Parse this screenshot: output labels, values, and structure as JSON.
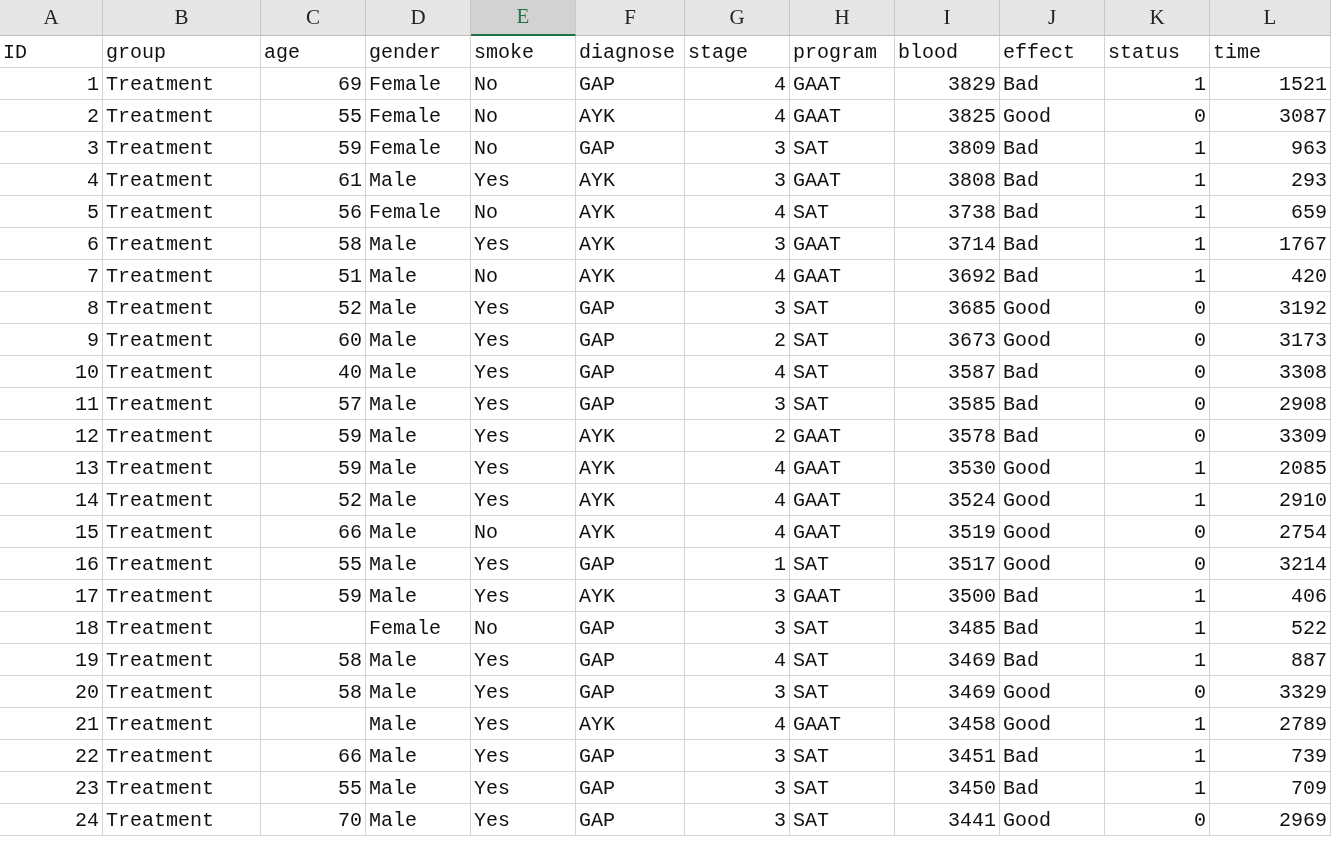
{
  "sheet": {
    "columns": [
      {
        "letter": "A",
        "selected": false,
        "kind": "number"
      },
      {
        "letter": "B",
        "selected": false,
        "kind": "text"
      },
      {
        "letter": "C",
        "selected": false,
        "kind": "number"
      },
      {
        "letter": "D",
        "selected": false,
        "kind": "text"
      },
      {
        "letter": "E",
        "selected": true,
        "kind": "text"
      },
      {
        "letter": "F",
        "selected": false,
        "kind": "text"
      },
      {
        "letter": "G",
        "selected": false,
        "kind": "number"
      },
      {
        "letter": "H",
        "selected": false,
        "kind": "text"
      },
      {
        "letter": "I",
        "selected": false,
        "kind": "number"
      },
      {
        "letter": "J",
        "selected": false,
        "kind": "text"
      },
      {
        "letter": "K",
        "selected": false,
        "kind": "number"
      },
      {
        "letter": "L",
        "selected": false,
        "kind": "number"
      }
    ],
    "header": [
      "ID",
      "group",
      "age",
      "gender",
      "smoke",
      "diagnose",
      "stage",
      "program",
      "blood",
      "effect",
      "status",
      "time"
    ],
    "rows": [
      [
        "1",
        "Treatment",
        "69",
        "Female",
        "No",
        "GAP",
        "4",
        "GAAT",
        "3829",
        "Bad",
        "1",
        "1521"
      ],
      [
        "2",
        "Treatment",
        "55",
        "Female",
        "No",
        "AYK",
        "4",
        "GAAT",
        "3825",
        "Good",
        "0",
        "3087"
      ],
      [
        "3",
        "Treatment",
        "59",
        "Female",
        "No",
        "GAP",
        "3",
        "SAT",
        "3809",
        "Bad",
        "1",
        "963"
      ],
      [
        "4",
        "Treatment",
        "61",
        "Male",
        "Yes",
        "AYK",
        "3",
        "GAAT",
        "3808",
        "Bad",
        "1",
        "293"
      ],
      [
        "5",
        "Treatment",
        "56",
        "Female",
        "No",
        "AYK",
        "4",
        "SAT",
        "3738",
        "Bad",
        "1",
        "659"
      ],
      [
        "6",
        "Treatment",
        "58",
        "Male",
        "Yes",
        "AYK",
        "3",
        "GAAT",
        "3714",
        "Bad",
        "1",
        "1767"
      ],
      [
        "7",
        "Treatment",
        "51",
        "Male",
        "No",
        "AYK",
        "4",
        "GAAT",
        "3692",
        "Bad",
        "1",
        "420"
      ],
      [
        "8",
        "Treatment",
        "52",
        "Male",
        "Yes",
        "GAP",
        "3",
        "SAT",
        "3685",
        "Good",
        "0",
        "3192"
      ],
      [
        "9",
        "Treatment",
        "60",
        "Male",
        "Yes",
        "GAP",
        "2",
        "SAT",
        "3673",
        "Good",
        "0",
        "3173"
      ],
      [
        "10",
        "Treatment",
        "40",
        "Male",
        "Yes",
        "GAP",
        "4",
        "SAT",
        "3587",
        "Bad",
        "0",
        "3308"
      ],
      [
        "11",
        "Treatment",
        "57",
        "Male",
        "Yes",
        "GAP",
        "3",
        "SAT",
        "3585",
        "Bad",
        "0",
        "2908"
      ],
      [
        "12",
        "Treatment",
        "59",
        "Male",
        "Yes",
        "AYK",
        "2",
        "GAAT",
        "3578",
        "Bad",
        "0",
        "3309"
      ],
      [
        "13",
        "Treatment",
        "59",
        "Male",
        "Yes",
        "AYK",
        "4",
        "GAAT",
        "3530",
        "Good",
        "1",
        "2085"
      ],
      [
        "14",
        "Treatment",
        "52",
        "Male",
        "Yes",
        "AYK",
        "4",
        "GAAT",
        "3524",
        "Good",
        "1",
        "2910"
      ],
      [
        "15",
        "Treatment",
        "66",
        "Male",
        "No",
        "AYK",
        "4",
        "GAAT",
        "3519",
        "Good",
        "0",
        "2754"
      ],
      [
        "16",
        "Treatment",
        "55",
        "Male",
        "Yes",
        "GAP",
        "1",
        "SAT",
        "3517",
        "Good",
        "0",
        "3214"
      ],
      [
        "17",
        "Treatment",
        "59",
        "Male",
        "Yes",
        "AYK",
        "3",
        "GAAT",
        "3500",
        "Bad",
        "1",
        "406"
      ],
      [
        "18",
        "Treatment",
        null,
        "Female",
        "No",
        "GAP",
        "3",
        "SAT",
        "3485",
        "Bad",
        "1",
        "522"
      ],
      [
        "19",
        "Treatment",
        "58",
        "Male",
        "Yes",
        "GAP",
        "4",
        "SAT",
        "3469",
        "Bad",
        "1",
        "887"
      ],
      [
        "20",
        "Treatment",
        "58",
        "Male",
        "Yes",
        "GAP",
        "3",
        "SAT",
        "3469",
        "Good",
        "0",
        "3329"
      ],
      [
        "21",
        "Treatment",
        null,
        "Male",
        "Yes",
        "AYK",
        "4",
        "GAAT",
        "3458",
        "Good",
        "1",
        "2789"
      ],
      [
        "22",
        "Treatment",
        "66",
        "Male",
        "Yes",
        "GAP",
        "3",
        "SAT",
        "3451",
        "Bad",
        "1",
        "739"
      ],
      [
        "23",
        "Treatment",
        "55",
        "Male",
        "Yes",
        "GAP",
        "3",
        "SAT",
        "3450",
        "Bad",
        "1",
        "709"
      ],
      [
        "24",
        "Treatment",
        "70",
        "Male",
        "Yes",
        "GAP",
        "3",
        "SAT",
        "3441",
        "Good",
        "0",
        "2969"
      ]
    ]
  }
}
